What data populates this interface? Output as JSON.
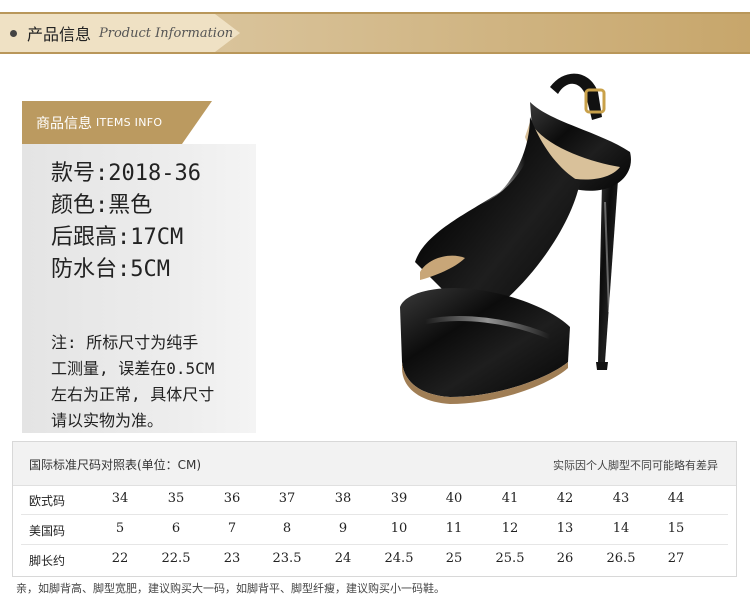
{
  "header": {
    "title_cn": "产品信息",
    "title_en": "Product Information"
  },
  "info": {
    "tab_cn": "商品信息",
    "tab_en": "ITEMS INFO",
    "specs": [
      "款号:2018-36",
      "颜色:黑色",
      "后跟高:17CM",
      "防水台:5CM"
    ],
    "note": [
      "注: 所标尺寸为纯手",
      "工测量, 误差在0.5CM",
      "左右为正常, 具体尺寸",
      "请以实物为准。"
    ]
  },
  "size_table": {
    "title": "国际标准尺码对照表(单位：CM)",
    "note": "实际因个人脚型不同可能略有差异",
    "rows": [
      {
        "label": "欧式码",
        "values": [
          "34",
          "35",
          "36",
          "37",
          "38",
          "39",
          "40",
          "41",
          "42",
          "43",
          "44"
        ]
      },
      {
        "label": "美国码",
        "values": [
          "5",
          "6",
          "7",
          "8",
          "9",
          "10",
          "11",
          "12",
          "13",
          "14",
          "15"
        ]
      },
      {
        "label": "脚长约",
        "values": [
          "22",
          "22.5",
          "23",
          "23.5",
          "24",
          "24.5",
          "25",
          "25.5",
          "26",
          "26.5",
          "27"
        ]
      }
    ]
  },
  "footer": "亲，如脚背高、脚型宽肥，建议购买大一码，如脚背平、脚型纤瘦，建议购买小一码鞋。",
  "colors": {
    "gold": "#bb9a60",
    "header_bar": "#c9ad76"
  }
}
